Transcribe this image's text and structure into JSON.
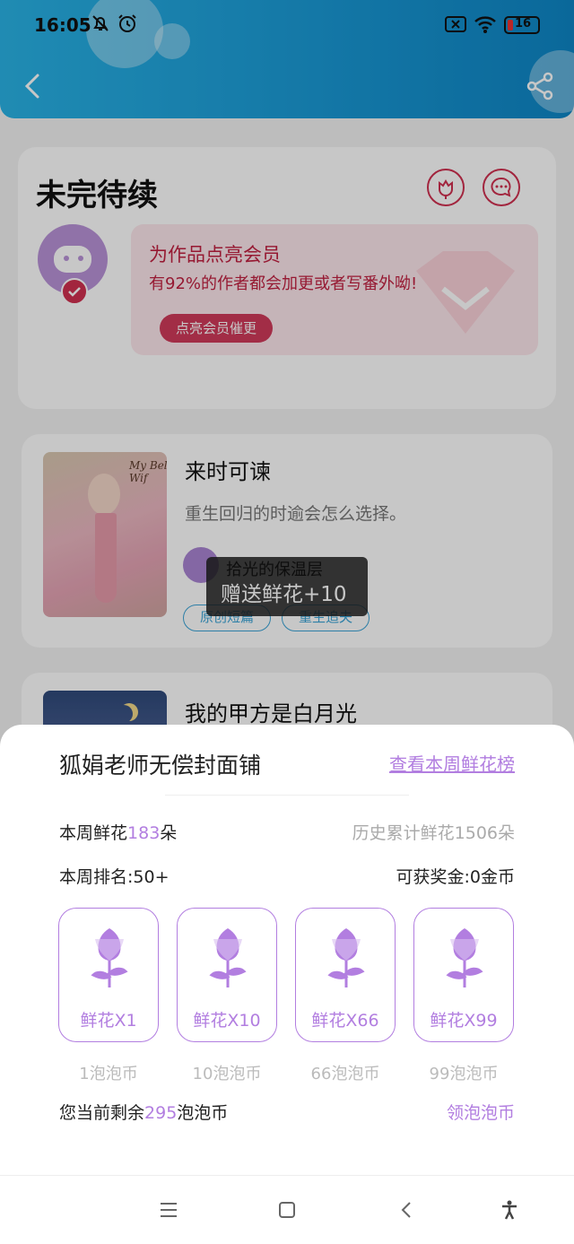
{
  "status_bar": {
    "time": "16:05",
    "battery": "16"
  },
  "header": {
    "back_icon": "back-arrow-icon",
    "share_icon": "share-icon"
  },
  "work_card": {
    "title": "未完待续",
    "promo_title": "为作品点亮会员",
    "promo_subtitle": "有92%的作者都会加更或者写番外呦!",
    "promo_button": "点亮会员催更"
  },
  "book1": {
    "title": "来时可谏",
    "description": "重生回归的时逾会怎么选择。",
    "cover_text": "My Bel Wif",
    "tags": [
      "原创短篇",
      "重生追夫"
    ]
  },
  "toast": {
    "user": "拾光的保温层",
    "message": "赠送鲜花+10"
  },
  "book2": {
    "title": "我的甲方是白月光"
  },
  "sheet": {
    "title": "狐娟老师无偿封面铺",
    "rank_link": "查看本周鲜花榜",
    "week_flowers_prefix": "本周鲜花",
    "week_flowers_value": "183",
    "week_flowers_suffix": "朵",
    "history_flowers": "历史累计鲜花1506朵",
    "week_rank": "本周排名:50+",
    "prize": "可获奖金:0金币",
    "options": [
      {
        "label": "鲜花X1",
        "price": "1泡泡币"
      },
      {
        "label": "鲜花X10",
        "price": "10泡泡币"
      },
      {
        "label": "鲜花X66",
        "price": "66泡泡币"
      },
      {
        "label": "鲜花X99",
        "price": "99泡泡币"
      }
    ],
    "balance_prefix": "您当前剩余",
    "balance_value": "295",
    "balance_suffix": "泡泡币",
    "get_coins": "领泡泡币"
  },
  "colors": {
    "accent": "#b27ee0",
    "header": "#1a9ad6",
    "promo": "#d03050"
  }
}
